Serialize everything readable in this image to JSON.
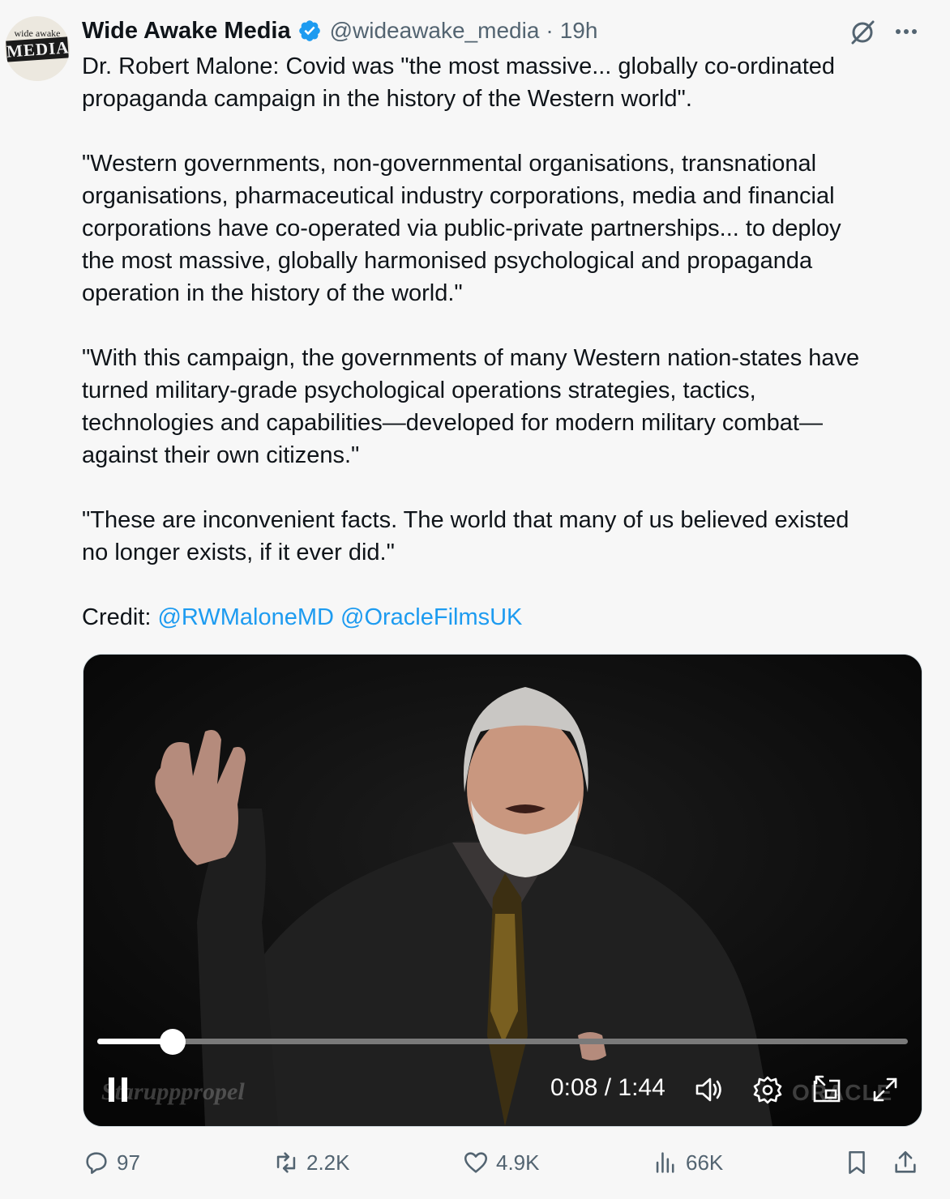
{
  "author": {
    "avatar_top": "wide awake",
    "avatar_bottom": "MEDIA",
    "name": "Wide Awake Media",
    "handle": "@wideawake_media",
    "separator": "·",
    "time": "19h"
  },
  "tweet": {
    "lines": [
      "Dr. Robert Malone: Covid was \"the most massive... globally co-ordinated",
      "propaganda campaign in the history of the Western world\".",
      "\"Western governments, non-governmental organisations, transnational",
      "organisations, pharmaceutical industry corporations, media and financial",
      "corporations have co-operated via public-private partnerships... to deploy",
      "the most massive, globally harmonised psychological and propaganda",
      "operation in the history of the world.\"",
      "\"With this campaign, the governments of many Western nation-states have",
      "turned military-grade psychological operations strategies, tactics,",
      "technologies and capabilities—developed for modern military combat—",
      "against their own citizens.\"",
      "\"These are inconvenient facts. The world that many of us believed existed",
      "no longer exists, if it ever did.\""
    ],
    "credit_label": "Credit:",
    "credit_mention_1": "@RWMaloneMD",
    "credit_mention_2": "@OracleFilmsUK"
  },
  "video": {
    "current_time": "0:08",
    "time_separator": "/",
    "duration": "1:44",
    "time_display": "0:08 / 1:44",
    "progress_fraction": 0.093,
    "watermark_left": "Starupppropel",
    "watermark_right": "ORACLE"
  },
  "actions": {
    "replies": "97",
    "reposts": "2.2K",
    "likes": "4.9K",
    "views": "66K"
  },
  "icons": {
    "verified": "verified-badge-icon",
    "grok": "grok-icon",
    "more": "more-icon",
    "pause": "pause-icon",
    "volume": "volume-icon",
    "settings": "settings-icon",
    "pip": "picture-in-picture-icon",
    "fullscreen": "fullscreen-icon",
    "reply": "reply-icon",
    "repost": "repost-icon",
    "like": "like-icon",
    "views": "views-icon",
    "bookmark": "bookmark-icon",
    "share": "share-icon"
  },
  "colors": {
    "link": "#1d9bf0",
    "verified": "#1d9bf0",
    "muted": "#536471",
    "text": "#0f1419"
  }
}
